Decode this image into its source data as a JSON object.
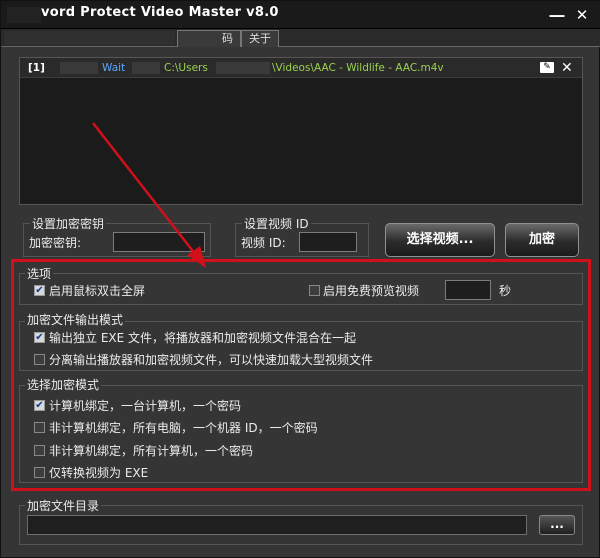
{
  "window": {
    "title": "vord Protect Video Master v8.0",
    "minimize": "―",
    "close": "✕"
  },
  "tabs": {
    "first": "码",
    "about": "关于"
  },
  "file_list": {
    "rows": [
      {
        "index": "[1]",
        "status": "Wait",
        "source": "C:\\Users",
        "path": "\\Videos\\AAC - Wildlife - AAC.m4v"
      }
    ]
  },
  "key_panel": {
    "group": "设置加密密钥",
    "label": "加密密钥:",
    "value": ""
  },
  "video_id_panel": {
    "group": "设置视频 ID",
    "label": "视频 ID:",
    "value": ""
  },
  "buttons": {
    "select_video": "选择视频...",
    "encrypt": "加密",
    "browse": "..."
  },
  "options": {
    "title": "选项",
    "fullscreen": {
      "label": "启用鼠标双击全屏",
      "checked": true
    },
    "preview": {
      "label": "启用免费预览视频",
      "checked": false
    },
    "preview_seconds": "",
    "seconds_unit": "秒"
  },
  "output_mode": {
    "title": "加密文件输出模式",
    "opt1": {
      "label": "输出独立 EXE 文件，将播放器和加密视频文件混合在一起",
      "checked": true
    },
    "opt2": {
      "label": "分离输出播放器和加密视频文件，可以快速加载大型视频文件",
      "checked": false
    }
  },
  "encrypt_mode": {
    "title": "选择加密模式",
    "opt1": {
      "label": "计算机绑定，一台计算机，一个密码",
      "checked": true
    },
    "opt2": {
      "label": "非计算机绑定，所有电脑，一个机器 ID，一个密码",
      "checked": false
    },
    "opt3": {
      "label": "非计算机绑定，所有计算机，一个密码",
      "checked": false
    },
    "opt4": {
      "label": "仅转换视频为 EXE",
      "checked": false
    }
  },
  "output_dir": {
    "title": "加密文件目录",
    "value": ""
  },
  "colors": {
    "annotation_red": "#d0101b",
    "status_blue": "#5aa7ff",
    "path_green": "#9bd24e"
  }
}
